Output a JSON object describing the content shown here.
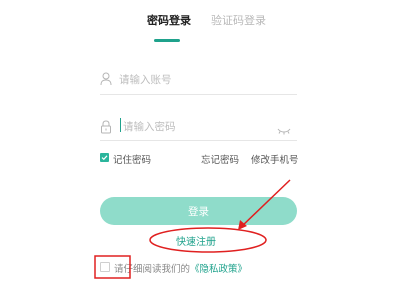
{
  "tabs": {
    "password_login": "密码登录",
    "code_login": "验证码登录"
  },
  "account": {
    "placeholder": "请输入账号",
    "icon": "user-icon"
  },
  "password": {
    "placeholder": "请输入密码",
    "icon": "lock-icon",
    "toggle_icon": "eye-closed-icon"
  },
  "options": {
    "remember_label": "记住密码",
    "remember_checked": true,
    "forgot_label": "忘记密码",
    "change_phone_label": "修改手机号"
  },
  "login_button": {
    "label": "登录"
  },
  "register_link": {
    "label": "快速注册"
  },
  "agreement": {
    "checked": false,
    "prefix": "请仔细阅读我们的",
    "link": "《隐私政策》"
  },
  "colors": {
    "accent": "#1fa28c",
    "button": "#8fdcca",
    "annotation": "#e02020"
  }
}
